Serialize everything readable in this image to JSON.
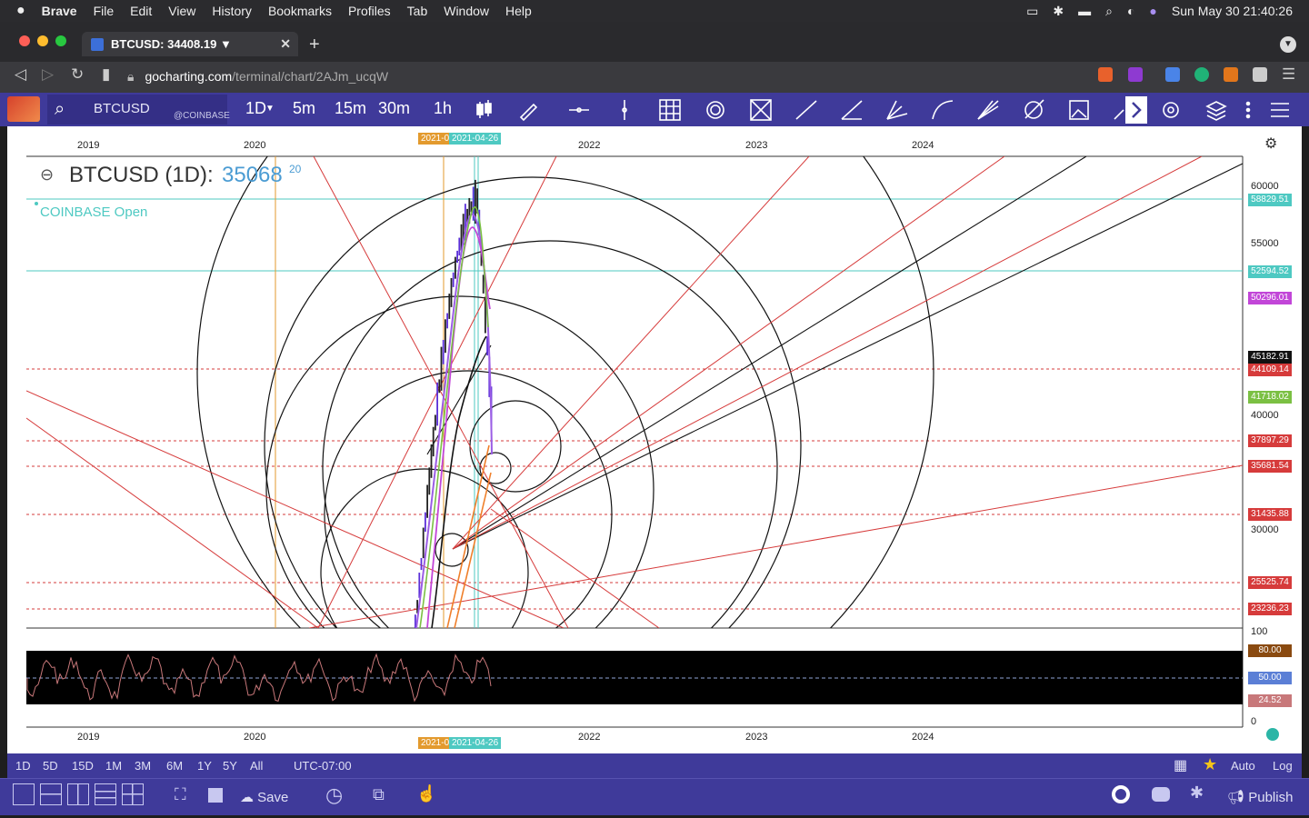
{
  "menubar": {
    "apple": "",
    "app": "Brave",
    "items": [
      "File",
      "Edit",
      "View",
      "History",
      "Bookmarks",
      "Profiles",
      "Tab",
      "Window",
      "Help"
    ],
    "clock": "Sun May 30  21:40:26"
  },
  "tab": {
    "title": "BTCUSD: 34408.19 ▼",
    "close": "✕",
    "new": "+"
  },
  "address": {
    "host": "gocharting.com",
    "path": "/terminal/chart/2AJm_ucqW"
  },
  "toolbar": {
    "symbol": "BTCUSD",
    "exchange": "@COINBASE",
    "interval": "1D",
    "timeframes": [
      "5m",
      "15m",
      "30m",
      "1h"
    ]
  },
  "chart": {
    "title_symbol": "BTCUSD (1D):",
    "price_main": "35068",
    "price_sup": "20",
    "exchange_status": "COINBASE Open",
    "years_top": [
      "2019",
      "2020",
      "2021-0",
      "2021-04-26",
      "2022",
      "2023",
      "2024"
    ],
    "years_bottom": [
      "2019",
      "2020",
      "2021-0",
      "2021-04-26",
      "2022",
      "2023",
      "2024"
    ],
    "y_ticks": [
      "60000",
      "55000",
      "40000",
      "30000"
    ],
    "price_labels": [
      {
        "text": "58829.51",
        "color": "#4ec9c2"
      },
      {
        "text": "52594.52",
        "color": "#4ec9c2"
      },
      {
        "text": "50296.01",
        "color": "#c246d8"
      },
      {
        "text": "45182.91",
        "color": "#111111"
      },
      {
        "text": "44109.14",
        "color": "#d63b3b"
      },
      {
        "text": "41718.02",
        "color": "#7bc043"
      },
      {
        "text": "37897.29",
        "color": "#d63b3b"
      },
      {
        "text": "35681.54",
        "color": "#d63b3b"
      },
      {
        "text": "31435.88",
        "color": "#d63b3b"
      },
      {
        "text": "25525.74",
        "color": "#d63b3b"
      },
      {
        "text": "23236.23",
        "color": "#d63b3b"
      }
    ],
    "rsi_ticks": [
      "100",
      "0"
    ],
    "rsi_labels": [
      {
        "text": "80.00",
        "color": "#8a4a10"
      },
      {
        "text": "50.00",
        "color": "#5b7fd6"
      },
      {
        "text": "24.52",
        "color": "#c8787a"
      }
    ]
  },
  "bottom1": {
    "ranges": [
      "1D",
      "5D",
      "15D",
      "1M",
      "3M",
      "6M",
      "1Y",
      "5Y",
      "All"
    ],
    "timezone": "UTC-07:00",
    "auto": "Auto",
    "log": "Log"
  },
  "bottom2": {
    "save": "Save",
    "publish": "Publish"
  }
}
